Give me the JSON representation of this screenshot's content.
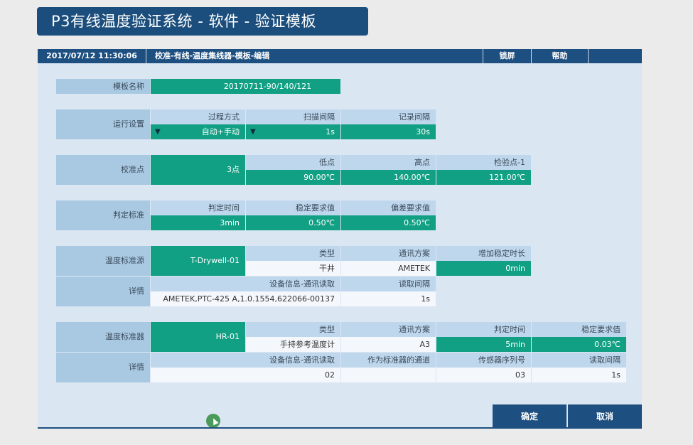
{
  "banner": {
    "title": "P3有线温度验证系统 - 软件 - 验证模板"
  },
  "topbar": {
    "datetime": "2017/07/12  11:30:06",
    "breadcrumb": "校准-有线-温度集线器-模板-编辑",
    "lock_label": "锁屏",
    "help_label": "帮助"
  },
  "template_name": {
    "label": "模板名称",
    "value": "20170711-90/140/121"
  },
  "run_settings": {
    "label": "运行设置",
    "process_mode": {
      "header": "过程方式",
      "value": "自动+手动"
    },
    "scan_interval": {
      "header": "扫描间隔",
      "value": "1s"
    },
    "record_interval": {
      "header": "记录间隔",
      "value": "30s"
    }
  },
  "calibration_points": {
    "label": "校准点",
    "count": "3点",
    "low": {
      "header": "低点",
      "value": "90.00℃"
    },
    "high": {
      "header": "高点",
      "value": "140.00℃"
    },
    "check": {
      "header": "检验点-1",
      "value": "121.00℃"
    }
  },
  "criteria": {
    "label": "判定标准",
    "time": {
      "header": "判定时间",
      "value": "3min"
    },
    "stability": {
      "header": "稳定要求值",
      "value": "0.50℃"
    },
    "deviation": {
      "header": "偏差要求值",
      "value": "0.50℃"
    }
  },
  "temp_source": {
    "label": "温度标准源",
    "device": "T-Drywell-01",
    "type": {
      "header": "类型",
      "value": "干井"
    },
    "protocol": {
      "header": "通讯方案",
      "value": "AMETEK"
    },
    "extra_stable": {
      "header": "增加稳定时长",
      "value": "0min"
    },
    "details_label": "详情",
    "device_info": {
      "header": "设备信息-通讯读取",
      "value": "AMETEK,PTC-425 A,1.0.1554,622066-00137"
    },
    "read_interval": {
      "header": "读取间隔",
      "value": "1s"
    }
  },
  "temp_standard": {
    "label": "温度标准器",
    "device": "HR-01",
    "type": {
      "header": "类型",
      "value": "手持参考温度计"
    },
    "protocol": {
      "header": "通讯方案",
      "value": "A3"
    },
    "judge_time": {
      "header": "判定时间",
      "value": "5min"
    },
    "stability": {
      "header": "稳定要求值",
      "value": "0.03℃"
    },
    "details_label": "详情",
    "device_info": {
      "header": "设备信息-通讯读取",
      "value": "02"
    },
    "channel": {
      "header": "作为标准器的通道",
      "value": ""
    },
    "sensor_serial": {
      "header": "传感器序列号",
      "value": "03"
    },
    "read_interval": {
      "header": "读取间隔",
      "value": "1s"
    }
  },
  "buttons": {
    "confirm": "确定",
    "cancel": "取消"
  },
  "icons": {
    "dropdown": "▼"
  },
  "colors": {
    "primary": "#1d4f80",
    "accent": "#11a084",
    "label_bg": "#a9c9e3"
  }
}
